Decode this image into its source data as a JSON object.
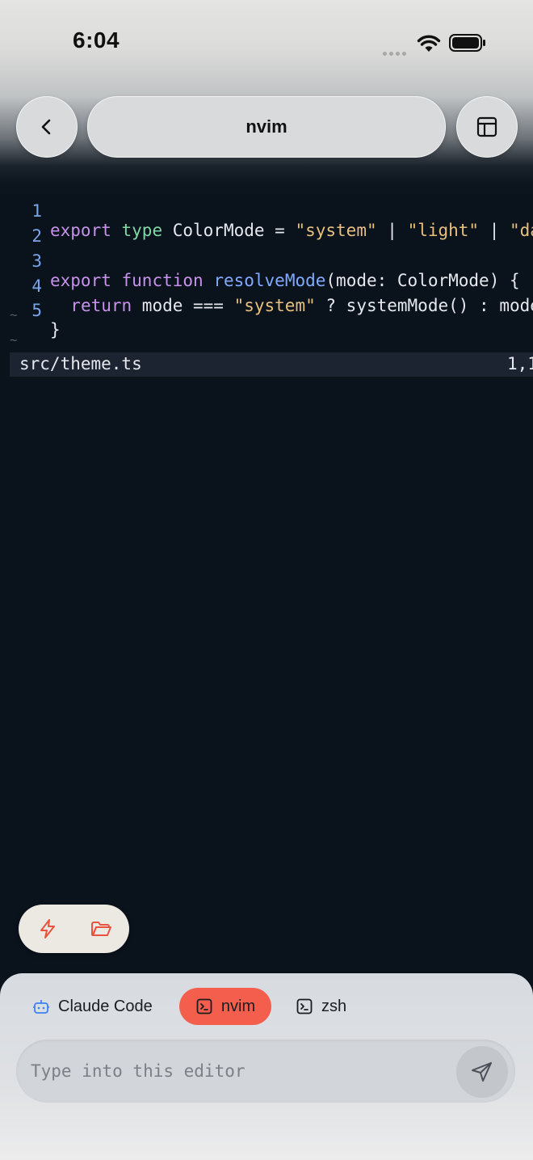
{
  "status_bar": {
    "time": "6:04"
  },
  "header": {
    "title": "nvim"
  },
  "editor": {
    "line_numbers": [
      "1",
      "2",
      "3",
      "4",
      "5"
    ],
    "lines": [
      [
        {
          "t": "export",
          "c": "kw"
        },
        {
          "t": " "
        },
        {
          "t": "type",
          "c": "ty"
        },
        {
          "t": " ColorMode = "
        },
        {
          "t": "\"system\"",
          "c": "str"
        },
        {
          "t": " | "
        },
        {
          "t": "\"light\"",
          "c": "str"
        },
        {
          "t": " | "
        },
        {
          "t": "\"da",
          "c": "str"
        }
      ],
      [],
      [
        {
          "t": "export",
          "c": "kw"
        },
        {
          "t": " "
        },
        {
          "t": "function",
          "c": "kw"
        },
        {
          "t": " "
        },
        {
          "t": "resolveMode",
          "c": "fn"
        },
        {
          "t": "(mode: ColorMode) {"
        }
      ],
      [
        {
          "t": "  "
        },
        {
          "t": "return",
          "c": "kw"
        },
        {
          "t": " mode === "
        },
        {
          "t": "\"system\"",
          "c": "str"
        },
        {
          "t": " ? systemMode() : mode"
        }
      ],
      [
        {
          "t": "}"
        }
      ]
    ],
    "tilde": "~",
    "status_file": "src/theme.ts",
    "status_position": "1,1"
  },
  "quick_actions": {
    "bolt_icon": "bolt-icon",
    "folder_icon": "folder-icon"
  },
  "tabs": [
    {
      "label": "Claude Code",
      "icon": "robot-icon",
      "active": false
    },
    {
      "label": "nvim",
      "icon": "terminal-icon",
      "active": true
    },
    {
      "label": "zsh",
      "icon": "terminal-icon",
      "active": false
    }
  ],
  "composer": {
    "placeholder": "Type into this editor"
  },
  "colors": {
    "accent": "#f45f4d",
    "keyword": "#c792ea",
    "type": "#7fd8a4",
    "function": "#82aaff",
    "string": "#e8c07d",
    "line_number": "#7aa6e8",
    "background": "#0a121c"
  }
}
